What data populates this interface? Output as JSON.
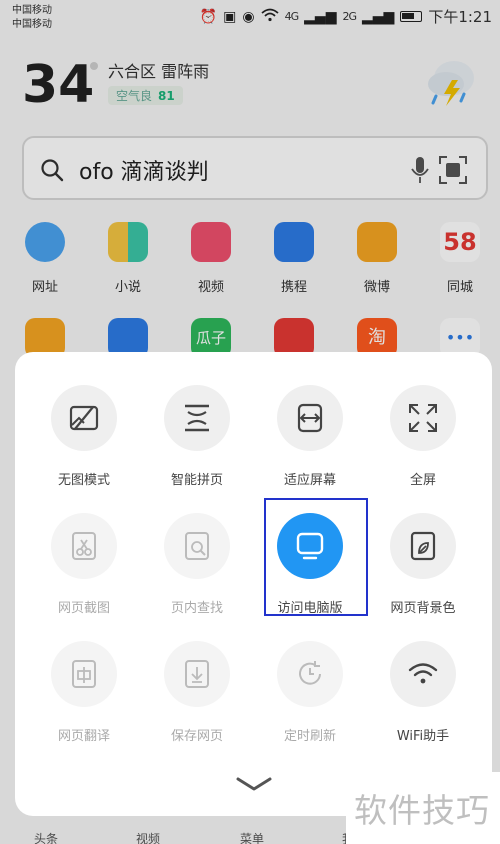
{
  "status_bar": {
    "carrier_1": "中国移动",
    "carrier_2": "中国移动",
    "network_1": "4G",
    "network_2": "2G",
    "time": "下午1:21"
  },
  "weather": {
    "temperature": "34",
    "location_condition": "六合区  雷阵雨",
    "air_label": "空气良",
    "air_value": "81"
  },
  "search": {
    "query": "ofo 滴滴谈判"
  },
  "shortcuts": [
    {
      "label": "网址",
      "color": "#4aa3f0"
    },
    {
      "label": "小说",
      "color": "#f4c542"
    },
    {
      "label": "视频",
      "color": "#f0506e"
    },
    {
      "label": "携程",
      "color": "#2d7be5"
    },
    {
      "label": "微博",
      "color": "#f5a623"
    },
    {
      "label": "同城",
      "color": "#e53935"
    }
  ],
  "shortcuts_row2": [
    {
      "label": "",
      "color": "#f5a623"
    },
    {
      "label": "",
      "color": "#2d7be5"
    },
    {
      "label": "瓜子",
      "color": "#2eb85c"
    },
    {
      "label": "",
      "color": "#e53935"
    },
    {
      "label": "淘",
      "color": "#ff5a1f"
    },
    {
      "label": "•••",
      "color": "#ffffff"
    }
  ],
  "menu": {
    "items": [
      {
        "label": "无图模式",
        "icon": "no-image-icon",
        "enabled": true
      },
      {
        "label": "智能拼页",
        "icon": "smart-page-icon",
        "enabled": true
      },
      {
        "label": "适应屏幕",
        "icon": "fit-screen-icon",
        "enabled": true
      },
      {
        "label": "全屏",
        "icon": "fullscreen-icon",
        "enabled": true
      },
      {
        "label": "网页截图",
        "icon": "screenshot-icon",
        "enabled": false
      },
      {
        "label": "页内查找",
        "icon": "find-in-page-icon",
        "enabled": false
      },
      {
        "label": "访问电脑版",
        "icon": "desktop-version-icon",
        "enabled": true,
        "active": true
      },
      {
        "label": "网页背景色",
        "icon": "background-color-icon",
        "enabled": true
      },
      {
        "label": "网页翻译",
        "icon": "translate-icon",
        "enabled": false
      },
      {
        "label": "保存网页",
        "icon": "save-page-icon",
        "enabled": false
      },
      {
        "label": "定时刷新",
        "icon": "timed-refresh-icon",
        "enabled": false
      },
      {
        "label": "WiFi助手",
        "icon": "wifi-icon",
        "enabled": true
      }
    ],
    "active_color": "#2196f3",
    "highlight_color": "#2233cc"
  },
  "bottom_nav": [
    "头条",
    "视频",
    "菜单",
    "我"
  ],
  "watermark": "软件技巧"
}
